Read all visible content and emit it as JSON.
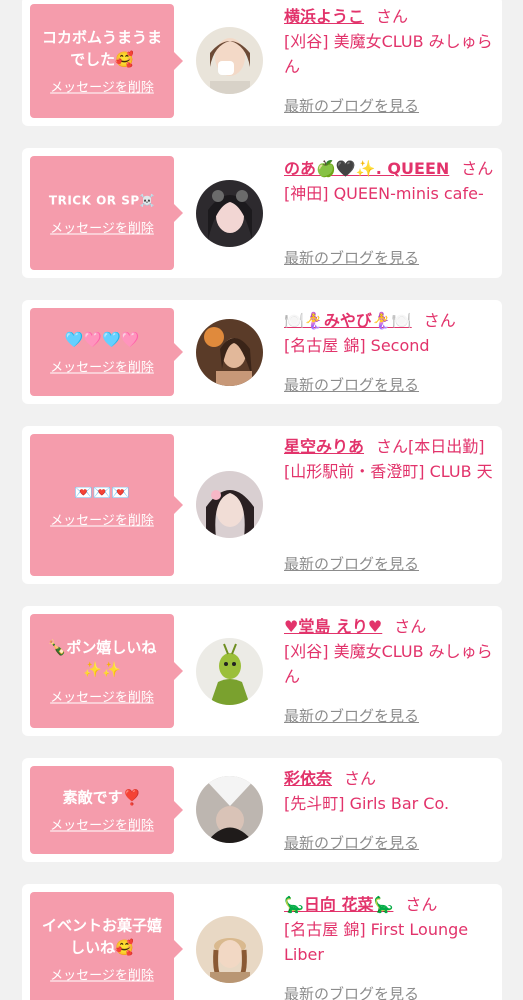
{
  "delete_label": "メッセージを削除",
  "blog_label": "最新のブログを見る",
  "suffix": "さん",
  "colors": {
    "bubble": "#f59cac",
    "accent": "#e2336b",
    "muted": "#8c8c8c",
    "page_bg": "#f1f1f1"
  },
  "items": [
    {
      "message": "コカボムうまうまでした🥰",
      "name": "横浜ようこ",
      "extra": "",
      "shop": "[刈谷] 美魔女CLUB みしゅらん"
    },
    {
      "message": "TRICK OR SP☠️",
      "name": "のあ🍏🖤✨. QUEEN",
      "extra": "",
      "shop": "[神田] QUEEN-minis cafe-"
    },
    {
      "message": "🩵🩷🩵🩷",
      "name": "🍽️🧜‍♀️みやび🧜‍♀️🍽️",
      "extra": "",
      "shop": "[名古屋 錦] Second"
    },
    {
      "message": "💌💌💌",
      "name": "星空みりあ",
      "extra": "[本日出勤]",
      "shop": "[山形駅前・香澄町] CLUB 天"
    },
    {
      "message": "🍾ポン嬉しいね✨✨",
      "name": "♥堂島 えり♥",
      "extra": "",
      "shop": "[刈谷] 美魔女CLUB みしゅらん"
    },
    {
      "message": "素敵です❣️",
      "name": "彩依奈",
      "extra": "",
      "shop": "[先斗町] Girls Bar Co."
    },
    {
      "message": "イベントお菓子嬉しいね🥰",
      "name": "🦕日向 花菜🦕",
      "extra": "",
      "shop": "[名古屋 錦] First Lounge Liber"
    }
  ]
}
